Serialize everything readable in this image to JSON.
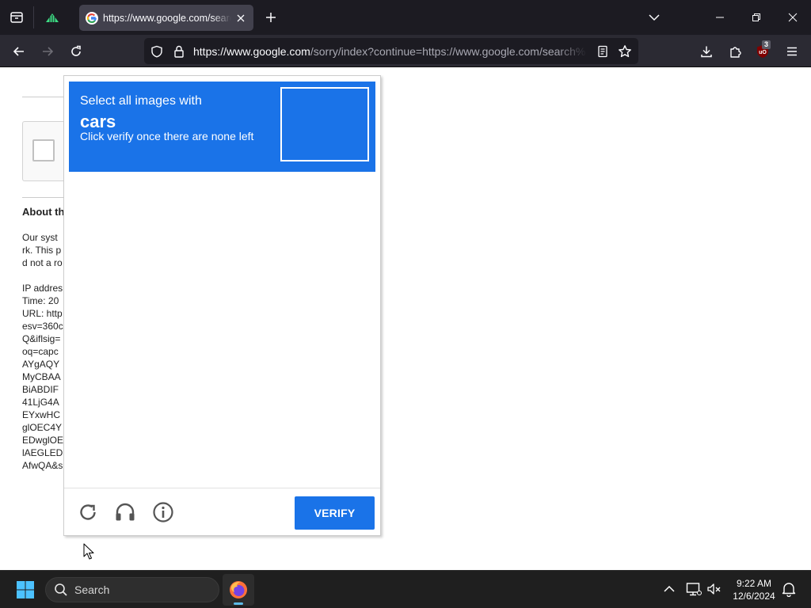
{
  "browser": {
    "tab": {
      "title": "https://www.google.com/search",
      "close_icon": "close-icon"
    },
    "url": {
      "host": "https://www.google.com",
      "path": "/sorry/index?continue=https://www.google.com/search%"
    },
    "extension_badge": "3",
    "accent_color": "#1c1b22"
  },
  "page": {
    "about_title": "About th",
    "about_lines": [
      "Our syst",
      "rk. This p",
      "d not a ro",
      "",
      "IP addres",
      "Time: 20",
      "URL: http",
      "esv=360c",
      "Q&iflsig=",
      "oq=capc",
      "AYgAQY",
      "MyCBAA",
      "BiABDIF",
      "41LjG4A",
      "EYxwHC",
      "glOEC4Y",
      "EDwglOE",
      "lAEGLED",
      "AfwQA&s"
    ]
  },
  "captcha": {
    "instruction": "Select all images with",
    "keyword": "cars",
    "subtext": "Click verify once there are none left",
    "verify_label": "VERIFY",
    "header_color": "#1a73e8"
  },
  "taskbar": {
    "search_label": "Search",
    "time": "9:22 AM",
    "date": "12/6/2024"
  }
}
